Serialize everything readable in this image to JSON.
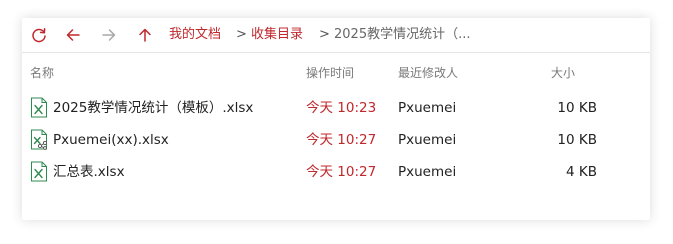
{
  "colors": {
    "accent": "#c0282d",
    "muted": "#7a7a7a",
    "text": "#222222",
    "excel_green": "#1f7a3e"
  },
  "toolbar": {
    "icons": [
      "refresh-icon",
      "back-arrow-icon",
      "forward-arrow-icon",
      "up-arrow-icon"
    ]
  },
  "breadcrumb": {
    "items": [
      "我的文档",
      "收集目录",
      "2025教学情况统计（..."
    ],
    "separator": ">"
  },
  "table": {
    "headers": {
      "name": "名称",
      "time": "操作时间",
      "modifier": "最近修改人",
      "size": "大小"
    },
    "rows": [
      {
        "name": "2025教学情况统计（模板）.xlsx",
        "time": "今天 10:23",
        "modifier": "Pxuemei",
        "size": "10 KB",
        "icon": "excel-file-icon"
      },
      {
        "name": "Pxuemei(xx).xlsx",
        "time": "今天 10:27",
        "modifier": "Pxuemei",
        "size": "10 KB",
        "icon": "excel-shared-file-icon"
      },
      {
        "name": "汇总表.xlsx",
        "time": "今天 10:27",
        "modifier": "Pxuemei",
        "size": "4 KB",
        "icon": "excel-file-icon"
      }
    ]
  }
}
